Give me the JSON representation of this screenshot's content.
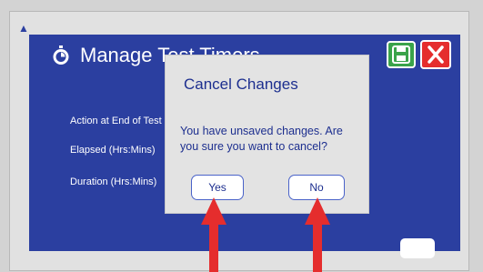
{
  "header": {
    "title": "Manage Test Timers"
  },
  "fields": [
    {
      "label": "Action at End of Test"
    },
    {
      "label": "Elapsed (Hrs:Mins)"
    },
    {
      "label": "Duration (Hrs:Mins)"
    }
  ],
  "dialog": {
    "title": "Cancel Changes",
    "message": "You have unsaved changes. Are you sure you want to cancel?",
    "yes_label": "Yes",
    "no_label": "No"
  },
  "colors": {
    "panel": "#2b3fa0",
    "save": "#3aa34a",
    "close": "#e52d2d",
    "arrow": "#e52d2d",
    "dialog_text": "#1d2f8f"
  },
  "icons": {
    "timer": "stopwatch-icon",
    "save": "floppy-disk-icon",
    "close": "close-icon",
    "arrows": "arrow-up-icon"
  }
}
